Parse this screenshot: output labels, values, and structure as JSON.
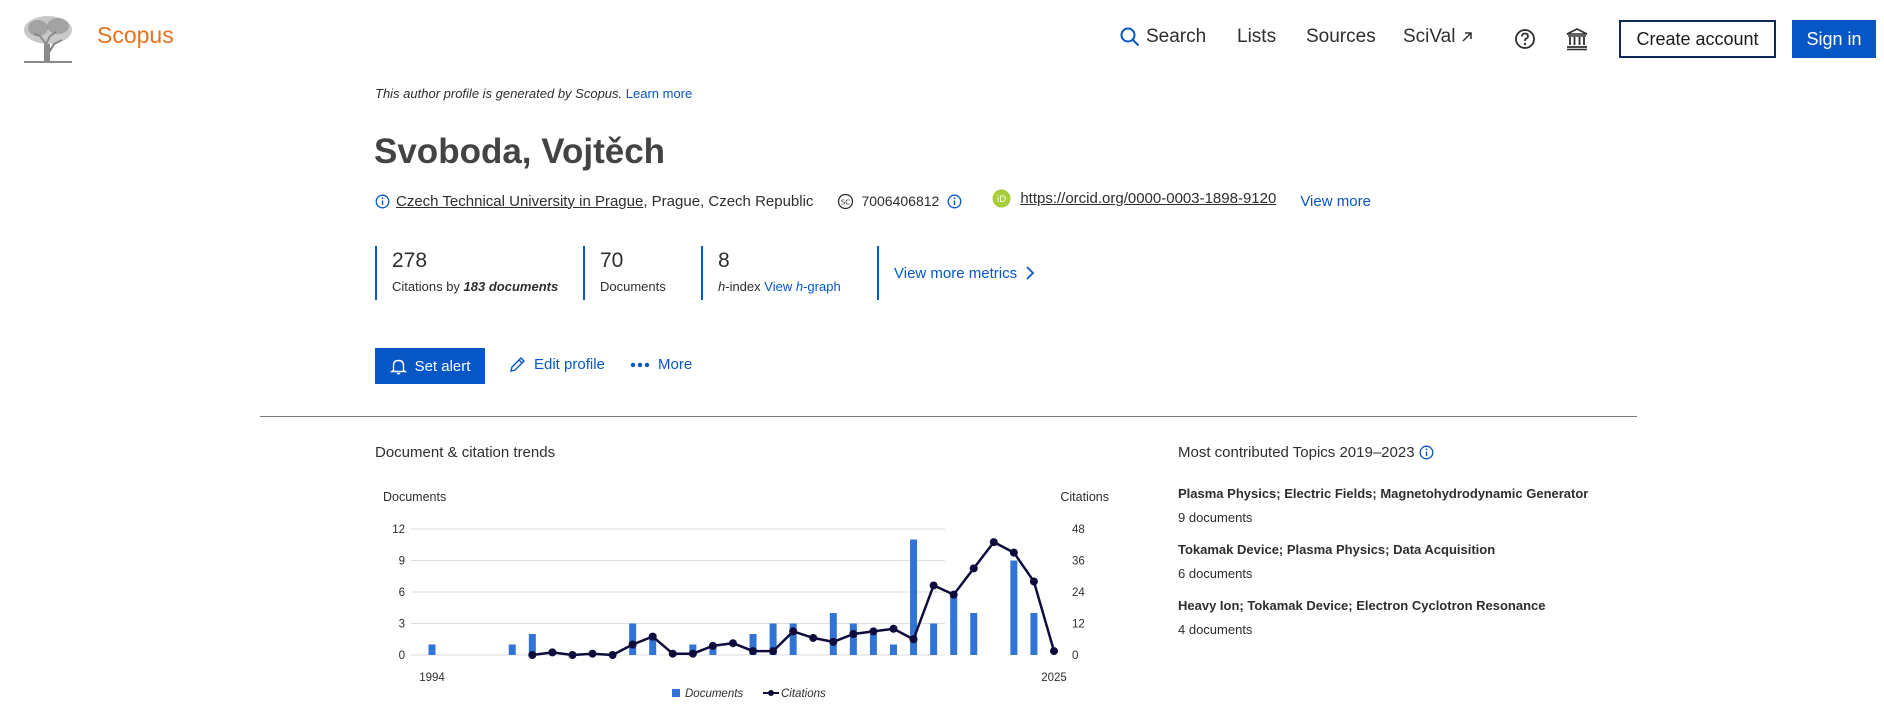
{
  "header": {
    "logo_text": "Scopus",
    "nav": {
      "search": "Search",
      "lists": "Lists",
      "sources": "Sources",
      "scival": "SciVal"
    },
    "create_account": "Create account",
    "sign_in": "Sign in"
  },
  "profile": {
    "generated_text": "This author profile is generated by Scopus.",
    "learn_more": "Learn more",
    "name": "Svoboda, Vojtěch",
    "affiliation": "Czech Technical University in Prague",
    "location": ", Prague, Czech Republic",
    "scopus_id": "7006406812",
    "orcid": "https://orcid.org/0000-0003-1898-9120",
    "view_more": "View more"
  },
  "metrics": {
    "citations": "278",
    "citations_label_pre": "Citations by",
    "citations_docs": "183 documents",
    "documents": "70",
    "documents_label": "Documents",
    "hindex": "8",
    "hindex_h": "h",
    "hindex_label": "-index",
    "view_hgraph_pre": "View",
    "view_hgraph_h": "h",
    "view_hgraph_post": "-graph",
    "view_more_metrics": "View more metrics"
  },
  "actions": {
    "set_alert": "Set alert",
    "edit_profile": "Edit profile",
    "more": "More"
  },
  "trends": {
    "title": "Document & citation trends"
  },
  "topics": {
    "title": "Most contributed Topics 2019–2023",
    "items": [
      {
        "name": "Plasma Physics; Electric Fields; Magnetohydrodynamic Generator",
        "count": "9 documents"
      },
      {
        "name": "Tokamak Device; Plasma Physics; Data Acquisition",
        "count": "6 documents"
      },
      {
        "name": "Heavy Ion; Tokamak Device; Electron Cyclotron Resonance",
        "count": "4 documents"
      }
    ]
  },
  "colors": {
    "accent": "#0656c5",
    "brand": "#e9711c",
    "bar": "#2f74d6",
    "line": "#0d0c3d"
  },
  "chart_data": {
    "type": "bar",
    "ylabel_left": "Documents",
    "ylabel_right": "Citations",
    "legend": [
      "Documents",
      "Citations"
    ],
    "yticks_left": [
      "12",
      "9",
      "6",
      "3",
      "0"
    ],
    "yticks_right": [
      "48",
      "36",
      "24",
      "12",
      "0"
    ],
    "xtick_start": "1994",
    "xtick_end": "2025",
    "ylim_left": [
      0,
      12
    ],
    "ylim_right": [
      0,
      48
    ],
    "years": [
      1994,
      1995,
      1996,
      1997,
      1998,
      1999,
      2000,
      2001,
      2002,
      2003,
      2004,
      2005,
      2006,
      2007,
      2008,
      2009,
      2010,
      2011,
      2012,
      2013,
      2014,
      2015,
      2016,
      2017,
      2018,
      2019,
      2020,
      2021,
      2022,
      2023,
      2024,
      2025
    ],
    "documents": [
      1,
      0,
      0,
      0,
      1,
      2,
      0,
      0,
      0,
      0,
      3,
      2,
      0,
      1,
      1,
      0,
      2,
      3,
      3,
      0,
      4,
      3,
      2,
      1,
      11,
      3,
      6,
      4,
      0,
      9,
      4,
      0
    ],
    "citations": [
      null,
      null,
      null,
      null,
      null,
      0,
      1,
      0,
      0.5,
      0,
      4,
      7,
      0.5,
      0.5,
      3.5,
      4.5,
      1.5,
      1.5,
      9,
      6.5,
      5,
      8,
      9,
      10,
      6,
      26.5,
      23,
      33,
      43,
      39,
      28,
      1.5
    ]
  }
}
